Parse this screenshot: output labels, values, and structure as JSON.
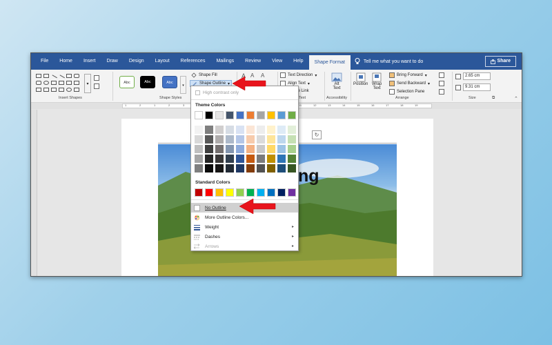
{
  "menu": {
    "tabs": [
      "File",
      "Home",
      "Insert",
      "Draw",
      "Design",
      "Layout",
      "References",
      "Mailings",
      "Review",
      "View",
      "Help",
      "Shape Format"
    ],
    "active_tab": "Shape Format",
    "tell_me": "Tell me what you want to do",
    "share_label": "Share"
  },
  "ribbon": {
    "insert_shapes_label": "Insert Shapes",
    "shape_styles_label": "Shape Styles",
    "style_buttons": [
      "Abc",
      "Abc",
      "Abc"
    ],
    "shape_fill_label": "Shape Fill",
    "shape_outline_label": "Shape Outline",
    "text_direction_label": "Text Direction",
    "align_text_label": "Align Text",
    "create_link_label": "te Link",
    "text_group_label": "Text",
    "alt_text_label_1": "Alt",
    "alt_text_label_2": "Text",
    "accessibility_label": "Accessibility",
    "position_label": "Position",
    "wrap_text_label_1": "Wrap",
    "wrap_text_label_2": "Text",
    "bring_forward_label": "Bring Forward",
    "send_backward_label": "Send Backward",
    "selection_pane_label": "Selection Pane",
    "arrange_label": "Arrange",
    "height_value": "2.65 cm",
    "width_value": "9.31 cm",
    "size_label": "Size"
  },
  "ruler": {
    "ticks": [
      "1",
      "2",
      "1",
      "2",
      "3",
      "4",
      "5",
      "6",
      "7",
      "8",
      "9",
      "10",
      "11",
      "12",
      "13",
      "14",
      "15",
      "16",
      "17",
      "18",
      "19"
    ]
  },
  "document": {
    "title_text": "ng"
  },
  "dropdown": {
    "high_contrast": "High contrast only",
    "theme_colors_label": "Theme Colors",
    "theme_colors": [
      "#ffffff",
      "#000000",
      "#e7e6e6",
      "#44546a",
      "#4472c4",
      "#ed7d31",
      "#a5a5a5",
      "#ffc000",
      "#5b9bd5",
      "#70ad47"
    ],
    "theme_tints": [
      [
        "#f2f2f2",
        "#7f7f7f",
        "#d0cece",
        "#d6dce4",
        "#d9e2f3",
        "#fbe5d5",
        "#ededed",
        "#fff2cc",
        "#deebf6",
        "#e2efd9"
      ],
      [
        "#d8d8d8",
        "#595959",
        "#aeabab",
        "#adb9ca",
        "#b4c6e7",
        "#f7cbac",
        "#dbdbdb",
        "#fee599",
        "#bdd7ee",
        "#c5e0b3"
      ],
      [
        "#bfbfbf",
        "#3f3f3f",
        "#757070",
        "#8496b0",
        "#8eaadb",
        "#f4b183",
        "#c9c9c9",
        "#ffd965",
        "#9cc3e5",
        "#a8d08d"
      ],
      [
        "#a5a5a5",
        "#262626",
        "#3a3838",
        "#323f4f",
        "#2f5496",
        "#c55a11",
        "#7b7b7b",
        "#bf9000",
        "#2e75b5",
        "#538135"
      ],
      [
        "#7f7f7f",
        "#0c0c0c",
        "#171616",
        "#222a35",
        "#1f3864",
        "#833c0b",
        "#525252",
        "#7f6000",
        "#1e4e79",
        "#375623"
      ]
    ],
    "standard_colors_label": "Standard Colors",
    "standard_colors": [
      "#c00000",
      "#ff0000",
      "#ffc000",
      "#ffff00",
      "#92d050",
      "#00b050",
      "#00b0f0",
      "#0070c0",
      "#002060",
      "#7030a0"
    ],
    "no_outline": "No Outline",
    "more_outline_colors": "More Outline Colors...",
    "weight": "Weight",
    "dashes": "Dashes",
    "arrows": "Arrows"
  },
  "icons": {
    "share": "share-icon",
    "tell_me": "lightbulb-icon",
    "annotation": "red-arrow-icon"
  }
}
